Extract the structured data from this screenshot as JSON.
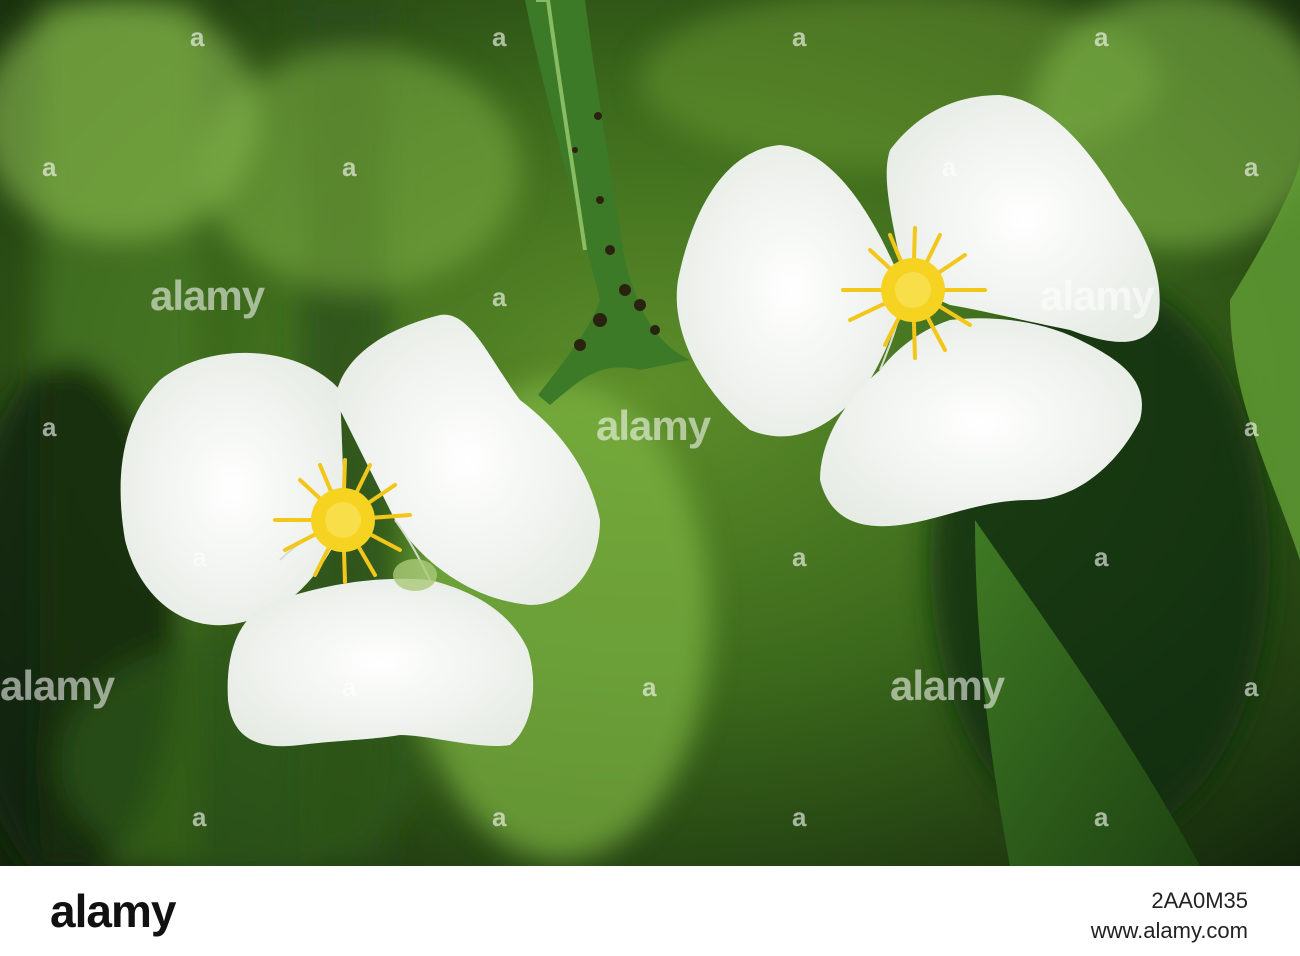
{
  "watermark": {
    "text": "alamy",
    "mark": "a"
  },
  "footer": {
    "brand": "alamy",
    "image_id": "2AA0M35",
    "site": "www.alamy.com"
  },
  "scene": {
    "subject": "two white three-petalled flowers with yellow stamens",
    "colors": {
      "petal": "#f7f8f5",
      "stamen": "#f3d21c",
      "leaf": "#4f8a2a",
      "background": "#1f3a14"
    }
  }
}
